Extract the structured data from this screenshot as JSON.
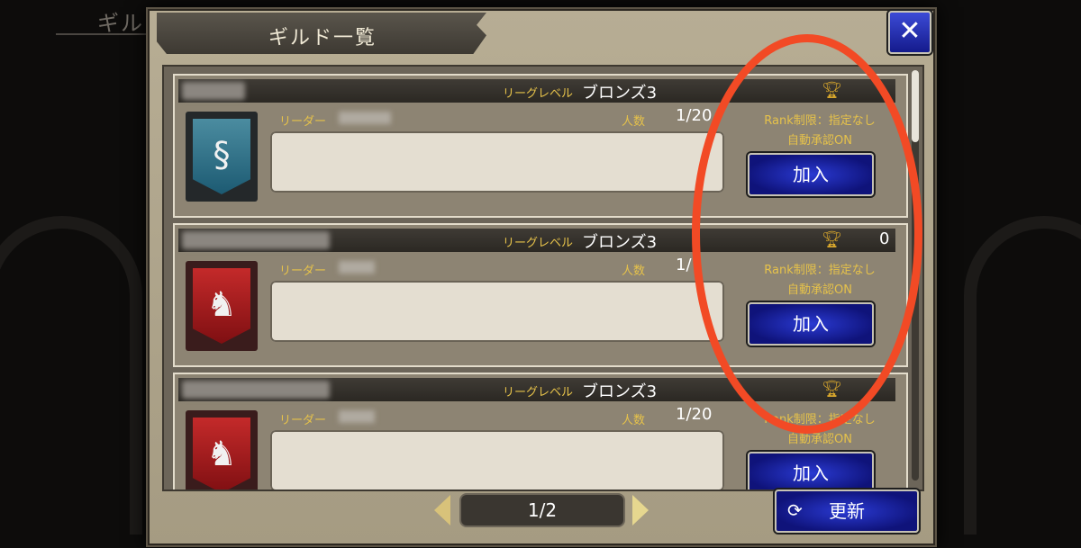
{
  "background": {
    "title": "ギル"
  },
  "dialog": {
    "title": "ギルド一覧",
    "close_label": "✕"
  },
  "guilds": [
    {
      "league_label": "リーグレベル",
      "league_value": "ブロンズ3",
      "score": "",
      "leader_label": "リーダー",
      "members_label": "人数",
      "members_value": "1/20",
      "rank_limit": "Rank制限：指定なし",
      "auto_approve": "自動承認ON",
      "join_label": "加入"
    },
    {
      "league_label": "リーグレベル",
      "league_value": "ブロンズ3",
      "score": "0",
      "leader_label": "リーダー",
      "members_label": "人数",
      "members_value": "1/",
      "rank_limit": "Rank制限：指定なし",
      "auto_approve": "自動承認ON",
      "join_label": "加入"
    },
    {
      "league_label": "リーグレベル",
      "league_value": "ブロンズ3",
      "score": "",
      "leader_label": "リーダー",
      "members_label": "人数",
      "members_value": "1/20",
      "rank_limit": "Rank制限：指定なし",
      "auto_approve": "自動承認ON",
      "join_label": "加入"
    }
  ],
  "pagination": {
    "current": "1/2"
  },
  "refresh": {
    "label": "更新"
  },
  "colors": {
    "highlight": "#f24a25",
    "button_blue": "#1a22b0",
    "gold": "#e6c24a"
  },
  "icons": {
    "close": "close-icon",
    "trophy": "trophy-icon",
    "refresh": "refresh-icon",
    "prev": "arrow-left-icon",
    "next": "arrow-right-icon"
  }
}
